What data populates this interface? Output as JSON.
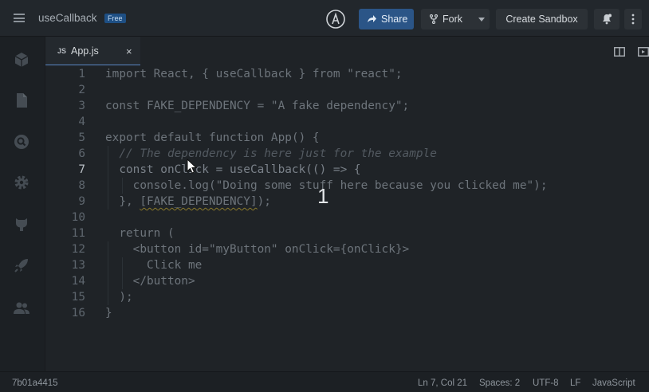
{
  "header": {
    "app_title": "useCallback",
    "plan_badge": "Free",
    "share_label": "Share",
    "fork_label": "Fork",
    "create_label": "Create Sandbox"
  },
  "tabs": [
    {
      "lang": "JS",
      "name": "App.js"
    }
  ],
  "tab_close_symbol": "×",
  "editor": {
    "active_line": 7,
    "lines": [
      "1",
      "2",
      "3",
      "4",
      "5",
      "6",
      "7",
      "8",
      "9",
      "10",
      "11",
      "12",
      "13",
      "14",
      "15",
      "16"
    ],
    "code": {
      "l1": "import React, { useCallback } from \"react\";",
      "l3": "const FAKE_DEPENDENCY = \"A fake dependency\";",
      "l5": "export default function App() {",
      "l6": "  // The dependency is here just for the example",
      "l7": "  const onClick = useCallback(() => {",
      "l8": "    console.log(\"Doing some stuff here because you clicked me\");",
      "l9a": "  }, ",
      "l9b": "[FAKE_DEPENDENCY]",
      "l9c": ");",
      "l11": "  return (",
      "l12": "    <button id=\"myButton\" onClick={onClick}>",
      "l13": "      Click me",
      "l14": "    </button>",
      "l15": "  );",
      "l16": "}"
    }
  },
  "overlay_number": "1",
  "status": {
    "commit": "7b01a4415",
    "cursor_pos": "Ln 7, Col 21",
    "spaces": "Spaces: 2",
    "encoding": "UTF-8",
    "eol": "LF",
    "language": "JavaScript"
  },
  "icons": {
    "sidebar": [
      "cube-icon",
      "file-icon",
      "search-icon",
      "gear-icon",
      "github-icon",
      "rocket-icon",
      "users-icon"
    ],
    "header": [
      "menu-icon",
      "codesandbox-logo-icon",
      "share-icon",
      "fork-icon",
      "bell-icon",
      "more-icon"
    ]
  },
  "colors": {
    "accent": "#2b5587",
    "background": "#1f2327",
    "tab_indicator": "#5a86c4"
  }
}
